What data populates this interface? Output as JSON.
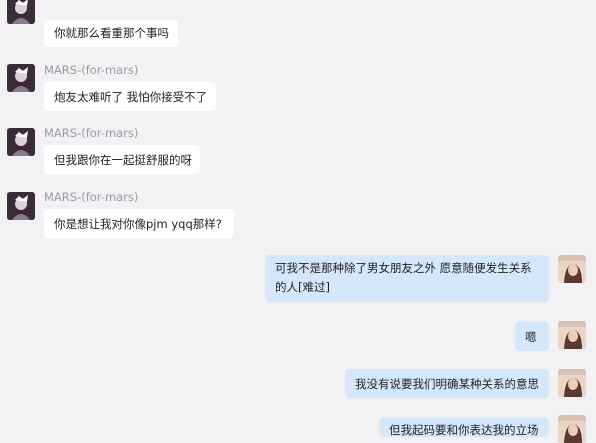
{
  "chat": {
    "messages": [
      {
        "side": "left",
        "sender": "",
        "text": "你就那么看重那个事吗"
      },
      {
        "side": "left",
        "sender": "MARS-(for-mars)",
        "text": "炮友太难听了 我怕你接受不了"
      },
      {
        "side": "left",
        "sender": "MARS-(for-mars)",
        "text": "但我跟你在一起挺舒服的呀"
      },
      {
        "side": "left",
        "sender": "MARS-(for-mars)",
        "text": "你是想让我对你像pjm yqq那样?"
      },
      {
        "side": "right",
        "sender": "",
        "text": "可我不是那种除了男女朋友之外 愿意随便发生关系的人[难过]"
      },
      {
        "side": "right",
        "sender": "",
        "text": "嗯"
      },
      {
        "side": "right",
        "sender": "",
        "text": "我没有说要我们明确某种关系的意思"
      },
      {
        "side": "right",
        "sender": "",
        "text": "但我起码要和你表达我的立场"
      }
    ]
  },
  "colors": {
    "background": "#f2f2f4",
    "left_bubble": "#ffffff",
    "right_bubble": "#d5e8fb",
    "sender_text": "#9a9aa2"
  },
  "icons": {
    "left_avatar": "dark-cartoon-avatar-icon",
    "right_avatar": "photo-avatar-icon"
  }
}
